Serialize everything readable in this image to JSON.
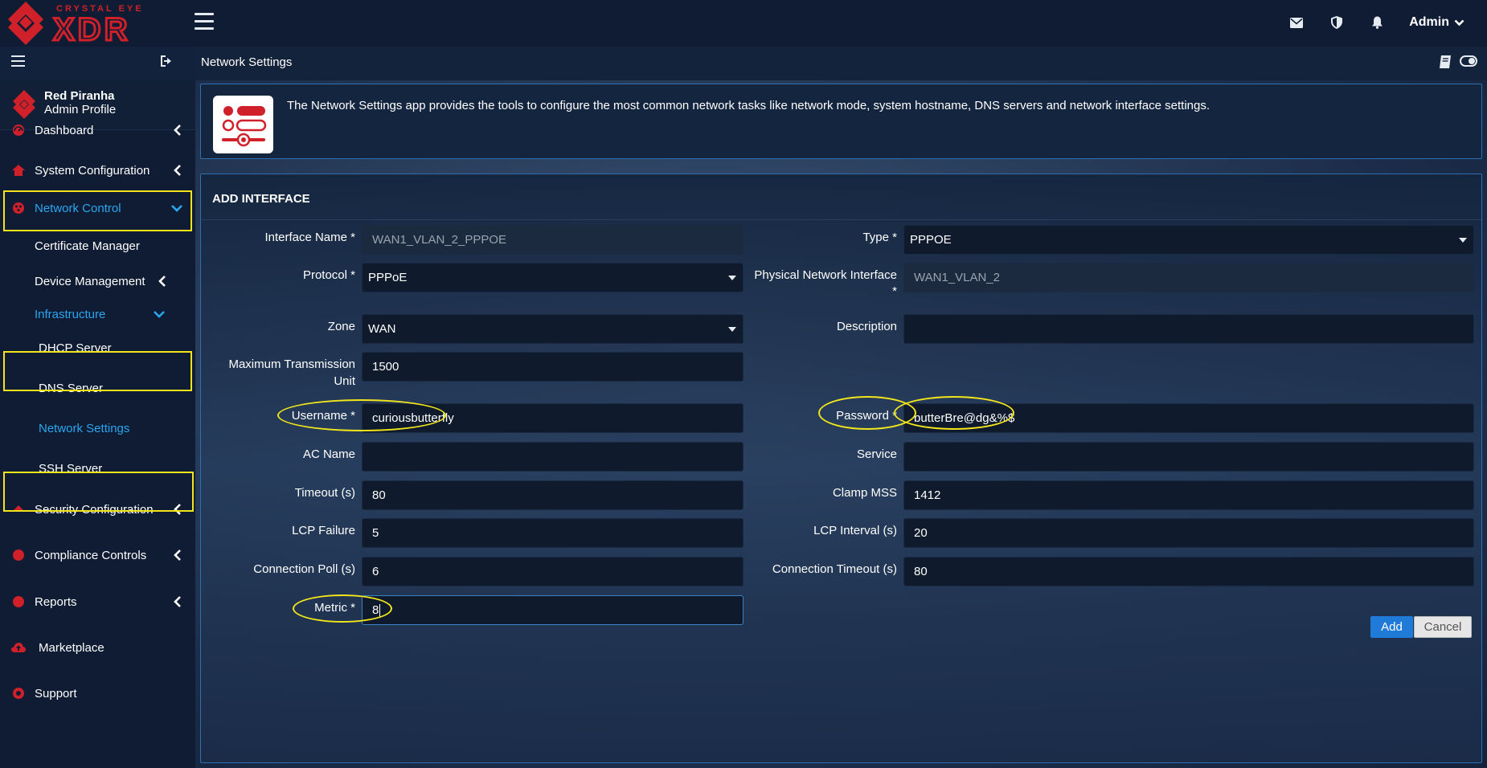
{
  "brand": {
    "tagline": "CRYSTAL EYE",
    "name": "XDR",
    "accent_color": "#d0202a"
  },
  "topbar": {
    "icons": [
      "envelope-icon",
      "shield-icon",
      "bell-icon"
    ],
    "user_label": "Admin"
  },
  "profile": {
    "name": "Red Piranha",
    "role": "Admin Profile"
  },
  "sidebar": {
    "items": [
      {
        "label": "Dashboard",
        "icon": "dashboard-icon"
      },
      {
        "label": "System Configuration",
        "icon": "house-icon"
      },
      {
        "label": "Network Control",
        "icon": "network-icon",
        "active": true
      },
      {
        "label": "Certificate Manager"
      },
      {
        "label": "Device Management"
      },
      {
        "label": "Infrastructure",
        "active": true
      },
      {
        "label": "DHCP Server"
      },
      {
        "label": "DNS Server"
      },
      {
        "label": "Network Settings",
        "active": true
      },
      {
        "label": "SSH Server"
      },
      {
        "label": "Security Configuration",
        "icon": "shield-icon"
      },
      {
        "label": "Compliance Controls",
        "icon": "compliance-icon"
      },
      {
        "label": "Reports",
        "icon": "reports-icon"
      },
      {
        "label": "Marketplace",
        "icon": "cloud-icon"
      },
      {
        "label": "Support",
        "icon": "support-icon"
      }
    ]
  },
  "page": {
    "title": "Network Settings",
    "description": "The Network Settings app provides the tools to configure the most common network tasks like network mode, system hostname, DNS servers and network interface settings."
  },
  "form": {
    "title": "ADD INTERFACE",
    "fields": {
      "interface_name": {
        "label": "Interface Name *",
        "value": "WAN1_VLAN_2_PPPOE"
      },
      "type": {
        "label": "Type *",
        "value": "PPPOE"
      },
      "protocol": {
        "label": "Protocol *",
        "value": "PPPoE"
      },
      "physical_interface": {
        "label_line1": "Physical Network Interface",
        "label_line2": "*",
        "value": "WAN1_VLAN_2"
      },
      "zone": {
        "label": "Zone",
        "value": "WAN"
      },
      "description": {
        "label": "Description",
        "value": ""
      },
      "mtu": {
        "label_line1": "Maximum Transmission",
        "label_line2": "Unit",
        "value": "1500"
      },
      "username": {
        "label": "Username *",
        "value": "curiousbutterfly"
      },
      "password": {
        "label": "Password *",
        "value": "butterBre@dg&%$"
      },
      "ac_name": {
        "label": "AC Name",
        "value": ""
      },
      "service": {
        "label": "Service",
        "value": ""
      },
      "timeout": {
        "label": "Timeout (s)",
        "value": "80"
      },
      "clamp_mss": {
        "label": "Clamp MSS",
        "value": "1412"
      },
      "lcp_failure": {
        "label": "LCP Failure",
        "value": "5"
      },
      "lcp_interval": {
        "label": "LCP Interval (s)",
        "value": "20"
      },
      "connection_poll": {
        "label": "Connection Poll (s)",
        "value": "6"
      },
      "connection_timeout": {
        "label": "Connection Timeout (s)",
        "value": "80"
      },
      "metric": {
        "label": "Metric *",
        "value": "8"
      }
    },
    "add_label": "Add",
    "cancel_label": "Cancel"
  },
  "highlight_color": "#f2e61b"
}
